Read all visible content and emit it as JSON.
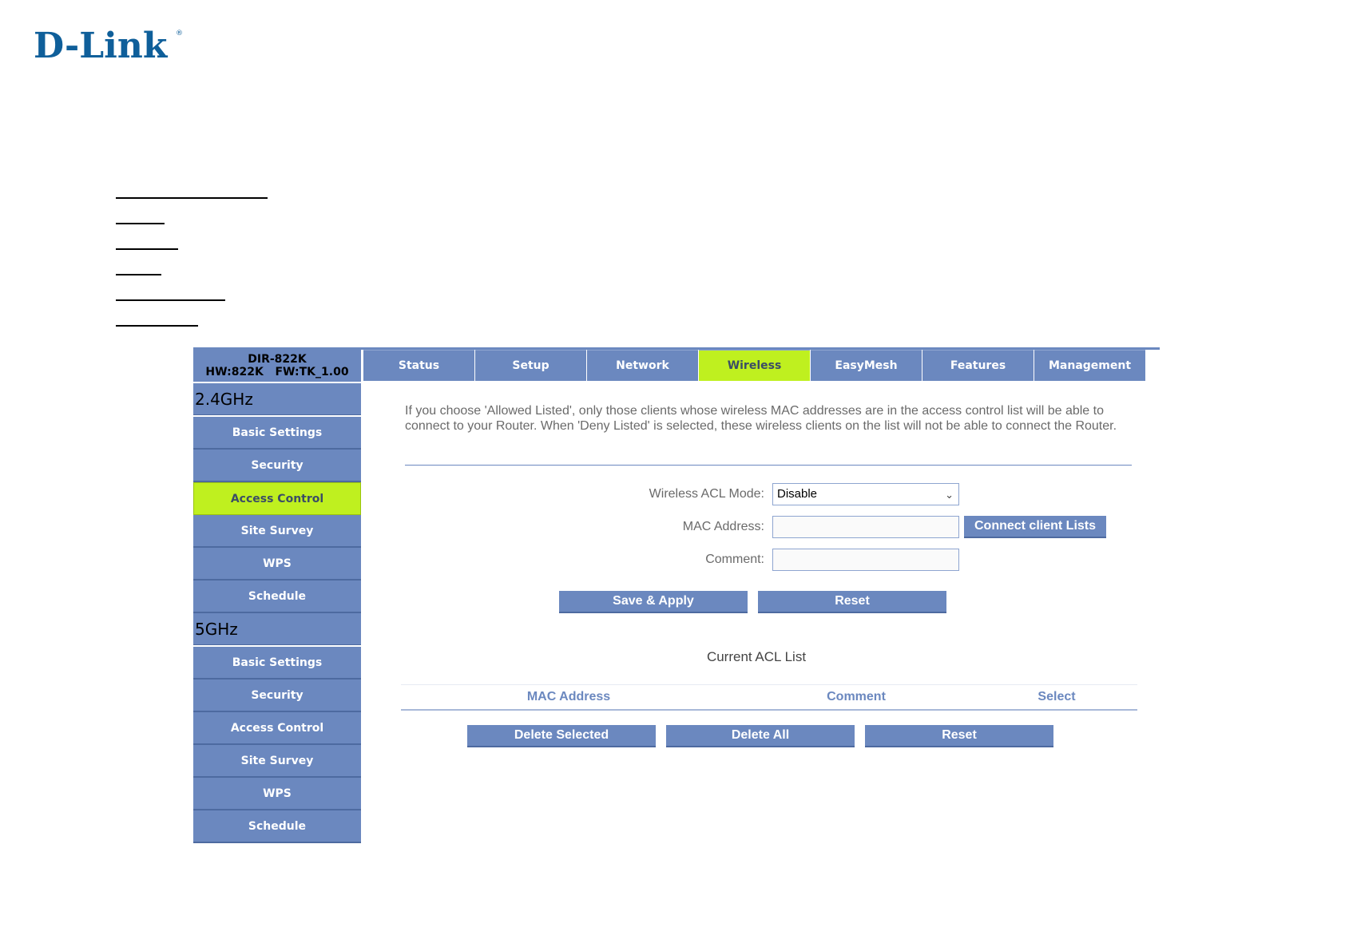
{
  "brand": {
    "logo_text": "D-Link",
    "registered": "®"
  },
  "device": {
    "model": "DIR-822K",
    "hw_fw": "HW:822K   FW:TK_1.00"
  },
  "tabs": [
    {
      "label": "Status",
      "active": false
    },
    {
      "label": "Setup",
      "active": false
    },
    {
      "label": "Network",
      "active": false
    },
    {
      "label": "Wireless",
      "active": true
    },
    {
      "label": "EasyMesh",
      "active": false
    },
    {
      "label": "Features",
      "active": false
    },
    {
      "label": "Management",
      "active": false
    }
  ],
  "sidebar": {
    "band24": "2.4GHz",
    "items24": [
      "Basic Settings",
      "Security",
      "Access Control",
      "Site Survey",
      "WPS",
      "Schedule"
    ],
    "band5": "5GHz",
    "items5": [
      "Basic Settings",
      "Security",
      "Access Control",
      "Site Survey",
      "WPS",
      "Schedule"
    ],
    "active": "2.4GHz / Access Control"
  },
  "main": {
    "intro": "If you choose 'Allowed Listed', only those clients whose wireless MAC addresses are in the access control list will be able to connect to your Router. When 'Deny Listed' is selected, these wireless clients on the list will not be able to connect the Router.",
    "acl_mode_label": "Wireless ACL Mode:",
    "acl_mode_value": "Disable",
    "mac_label": "MAC Address:",
    "mac_value": "",
    "comment_label": "Comment:",
    "comment_value": "",
    "connect_button": "Connect client Lists",
    "save_button": "Save & Apply",
    "reset_button": "Reset"
  },
  "acl_list": {
    "title": "Current ACL List",
    "columns": [
      "MAC Address",
      "Comment",
      "Select"
    ],
    "delete_selected": "Delete Selected",
    "delete_all": "Delete All",
    "reset": "Reset"
  },
  "colors": {
    "nav_blue": "#6b88bf",
    "active_green": "#bff01f",
    "logo_blue": "#0f5f9a"
  }
}
